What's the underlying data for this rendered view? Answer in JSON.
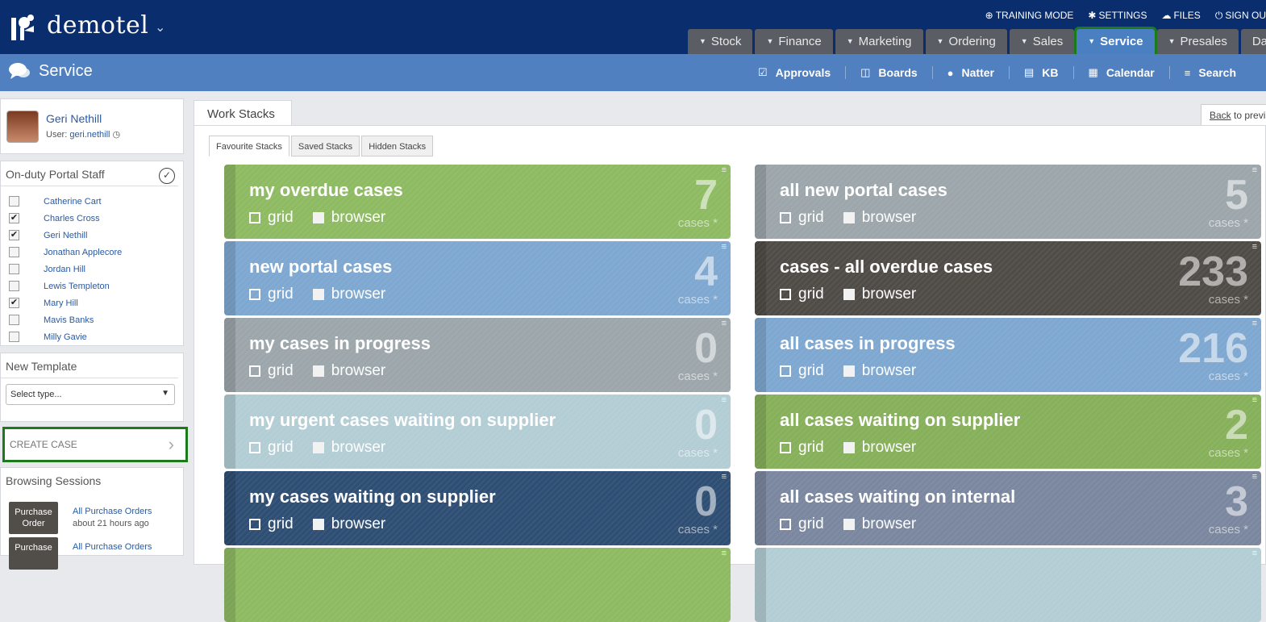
{
  "app": {
    "brand": "demotel",
    "logo_icon": "tree-logo-icon"
  },
  "top_links": [
    {
      "icon": "globe-icon",
      "label": "TRAINING MODE"
    },
    {
      "icon": "gear-icon",
      "label": "SETTINGS"
    },
    {
      "icon": "cloud-icon",
      "label": "FILES"
    },
    {
      "icon": "power-icon",
      "label": "SIGN OU"
    }
  ],
  "nav_tabs": [
    "Stock",
    "Finance",
    "Marketing",
    "Ordering",
    "Sales",
    "Service",
    "Presales",
    "Das"
  ],
  "active_tab": "Service",
  "section": {
    "title": "Service"
  },
  "sub_nav": [
    "Approvals",
    "Boards",
    "Natter",
    "KB",
    "Calendar",
    "Search"
  ],
  "profile": {
    "name": "Geri Nethill",
    "user_label": "User:",
    "username": "geri.nethill"
  },
  "duty": {
    "title": "On-duty Portal Staff",
    "staff": [
      {
        "name": "Catherine Cart",
        "checked": false
      },
      {
        "name": "Charles Cross",
        "checked": true
      },
      {
        "name": "Geri Nethill",
        "checked": true
      },
      {
        "name": "Jonathan Applecore",
        "checked": false
      },
      {
        "name": "Jordan Hill",
        "checked": false
      },
      {
        "name": "Lewis Templeton",
        "checked": false
      },
      {
        "name": "Mary Hill",
        "checked": true
      },
      {
        "name": "Mavis Banks",
        "checked": false
      },
      {
        "name": "Milly Gavie",
        "checked": false
      }
    ]
  },
  "template": {
    "title": "New Template",
    "select_value": "Select type..."
  },
  "create_case": {
    "label": "CREATE CASE"
  },
  "browsing": {
    "title": "Browsing Sessions",
    "sessions": [
      {
        "badge": "Purchase Order",
        "link": "All Purchase Orders",
        "time": "about 21 hours ago"
      },
      {
        "badge": "Purchase",
        "link": "All Purchase Orders",
        "time": ""
      }
    ]
  },
  "work_stacks": {
    "tab_label": "Work Stacks",
    "back_link": "Back",
    "back_rest": "to previ",
    "sub_tabs": [
      "Favourite Stacks",
      "Saved Stacks",
      "Hidden Stacks"
    ],
    "grid_label": "grid",
    "browser_label": "browser",
    "unit": "cases *",
    "cards": [
      {
        "title": "my overdue cases",
        "count": "7",
        "color": "#8ebb62"
      },
      {
        "title": "all new portal cases",
        "count": "5",
        "color": "#9ca6ab"
      },
      {
        "title": "new portal cases",
        "count": "4",
        "color": "#7ea8d1"
      },
      {
        "title": "cases - all overdue cases",
        "count": "233",
        "color": "#4f4b46"
      },
      {
        "title": "my cases in progress",
        "count": "0",
        "color": "#9ca6ab"
      },
      {
        "title": "all cases in progress",
        "count": "216",
        "color": "#7ea8d1"
      },
      {
        "title": "my urgent cases waiting on supplier",
        "count": "0",
        "color": "#b3cdd5"
      },
      {
        "title": "all cases waiting on supplier",
        "count": "2",
        "color": "#86b05a"
      },
      {
        "title": "my cases waiting on supplier",
        "count": "0",
        "color": "#2e4e73"
      },
      {
        "title": "all cases waiting on internal",
        "count": "3",
        "color": "#7a879f"
      },
      {
        "title": "",
        "count": "",
        "color": "#8ebb62"
      },
      {
        "title": "",
        "count": "",
        "color": "#b3cdd5"
      }
    ]
  }
}
